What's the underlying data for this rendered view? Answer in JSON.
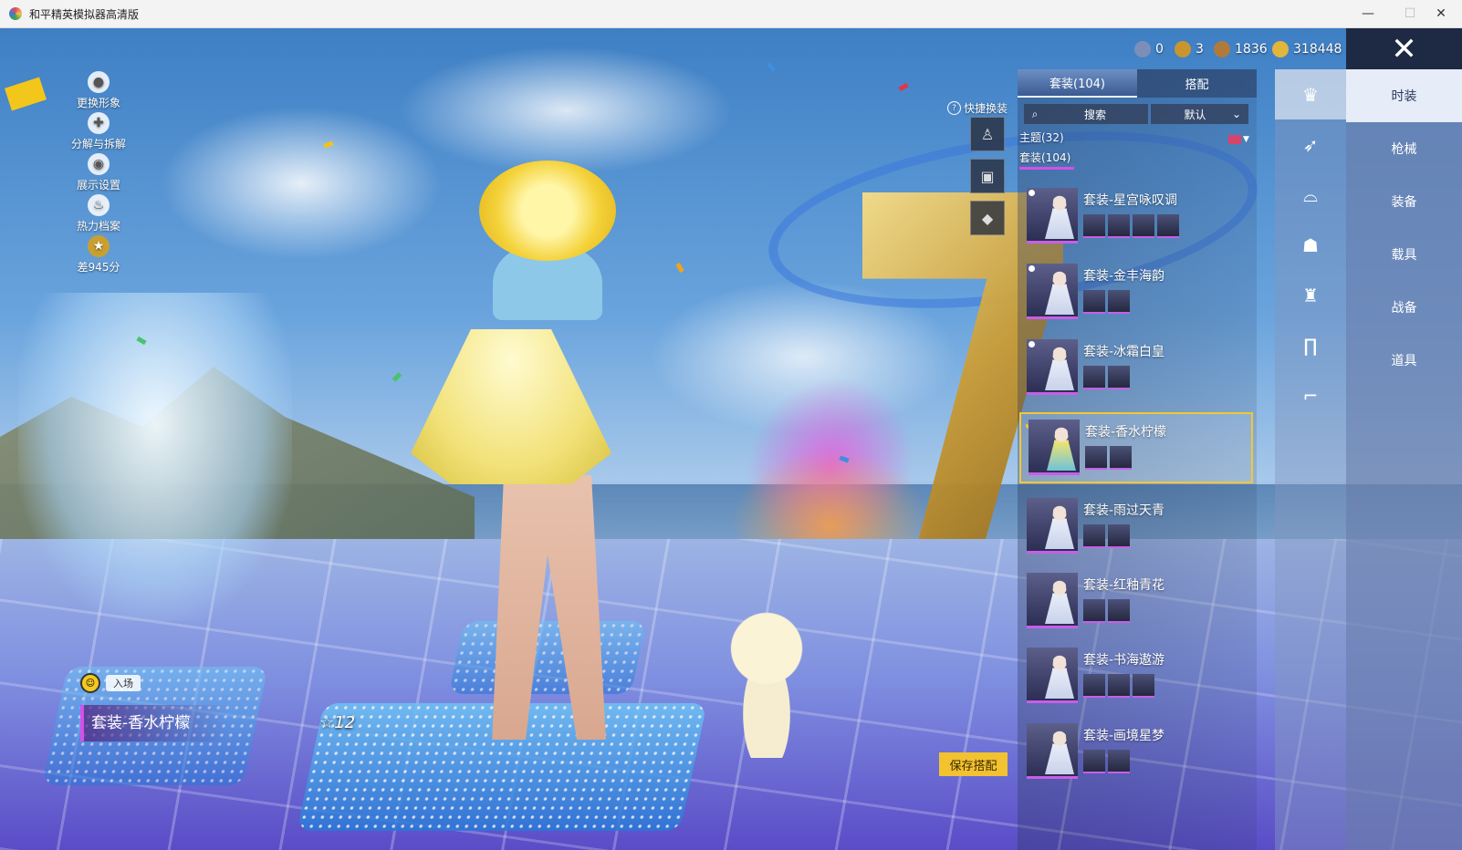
{
  "window": {
    "title": "和平精英模拟器高清版",
    "controls": [
      "—",
      "☐",
      "✕"
    ]
  },
  "left_menu": [
    {
      "label": "更换形象",
      "icon": "person-icon"
    },
    {
      "label": "分解与拆解",
      "icon": "puzzle-icon"
    },
    {
      "label": "展示设置",
      "icon": "eye-icon"
    },
    {
      "label": "热力档案",
      "icon": "flame-icon"
    },
    {
      "label": "差945分",
      "icon": "rank-badge-icon"
    }
  ],
  "currency": [
    {
      "value": "0",
      "color": "#7b8fb8"
    },
    {
      "value": "3",
      "color": "#c8962e"
    },
    {
      "value": "1836",
      "color": "#b07a3a"
    },
    {
      "value": "318448",
      "color": "#e2b63a"
    }
  ],
  "quick_change": {
    "label": "快捷换装",
    "help": "?"
  },
  "panel": {
    "tabs": [
      {
        "label": "套装(104)",
        "active": true
      },
      {
        "label": "搭配",
        "active": false
      }
    ],
    "search_placeholder": "搜索",
    "sort_label": "默认",
    "filters": [
      {
        "label": "主题(32)"
      },
      {
        "label": "套装(104)"
      }
    ],
    "items": [
      {
        "name": "套装-星宫咏叹调",
        "parts": 4,
        "selected": false
      },
      {
        "name": "套装-金丰海韵",
        "parts": 2,
        "selected": false
      },
      {
        "name": "套装-冰霜白皇",
        "parts": 2,
        "selected": false
      },
      {
        "name": "套装-香水柠檬",
        "parts": 2,
        "selected": true
      },
      {
        "name": "套装-雨过天青",
        "parts": 2,
        "selected": false
      },
      {
        "name": "套装-红釉青花",
        "parts": 2,
        "selected": false
      },
      {
        "name": "套装-书海遨游",
        "parts": 3,
        "selected": false
      },
      {
        "name": "套装-画境星梦",
        "parts": 2,
        "selected": false
      }
    ]
  },
  "save_button": "保存搭配",
  "current_outfit": {
    "entry_label": "入场",
    "name": "套装-香水柠檬",
    "pose_label": "☆12"
  },
  "categories": [
    {
      "label": "时装",
      "active": true
    },
    {
      "label": "枪械",
      "active": false
    },
    {
      "label": "装备",
      "active": false
    },
    {
      "label": "载具",
      "active": false
    },
    {
      "label": "战备",
      "active": false
    },
    {
      "label": "道具",
      "active": false
    }
  ],
  "category_icons": [
    "outfit-icon",
    "gun-icon",
    "glasses-icon",
    "mask-icon",
    "character-icon",
    "pants-icon",
    "socks-icon"
  ],
  "close_icon": "✕",
  "colors": {
    "accent_purple": "#d450e8",
    "selected_gold": "#f2c830",
    "save_yellow": "#f2c230"
  }
}
